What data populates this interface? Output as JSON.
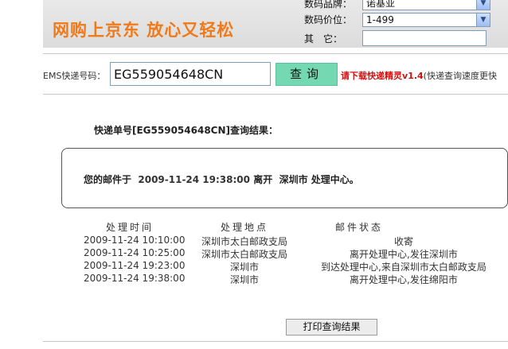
{
  "header": {
    "slogan": "网购上京东  放心又轻松",
    "brand_label": "数码品牌：",
    "brand_value": "诺基亚",
    "price_label": "数码价位：",
    "price_value": "1-499",
    "other_label": "其　它："
  },
  "tracking": {
    "label": "EMS快递号码：",
    "number": "EG559054648CN",
    "query_button": "查询",
    "promo_link": "请下载快递精灵v1.4",
    "promo_note": "(快递查询速度更快"
  },
  "result": {
    "title": "快递单号[EG559054648CN]查询结果：",
    "summary_prefix": "您的邮件于",
    "summary_time": "2009-11-24 19:38:00",
    "summary_action": "离开",
    "summary_place": "深圳市 处理中心。"
  },
  "table": {
    "headers": [
      "处理时间",
      "处理地点",
      "邮件状态"
    ],
    "rows": [
      {
        "time": "2009-11-24  10:10:00",
        "place": "深圳市太白邮政支局",
        "status": "收寄"
      },
      {
        "time": "2009-11-24  10:25:00",
        "place": "深圳市太白邮政支局",
        "status": "离开处理中心,发往深圳市"
      },
      {
        "time": "2009-11-24  19:23:00",
        "place": "深圳市",
        "status": "到达处理中心,来自深圳市太白邮政支局"
      },
      {
        "time": "2009-11-24  19:38:00",
        "place": "深圳市",
        "status": "离开处理中心,发往绵阳市"
      }
    ]
  },
  "print_button": "打印查询结果",
  "colors": {
    "slogan": "#f07a1a",
    "query_button": "#74d9b2",
    "promo": "#d41010"
  }
}
